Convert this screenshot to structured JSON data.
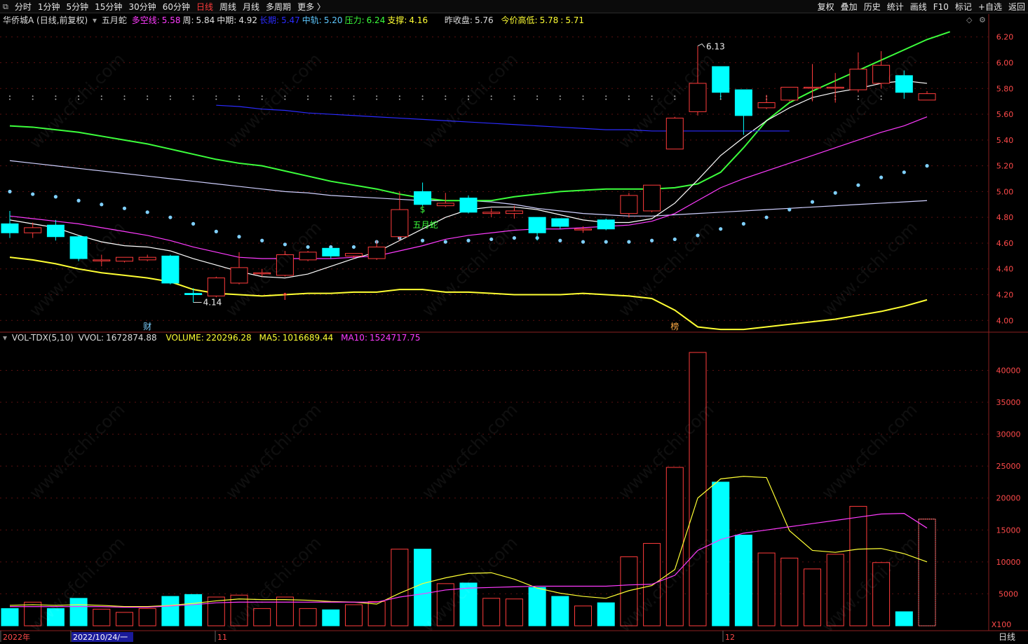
{
  "toolbar": {
    "left_icon": "stack-icon",
    "left": [
      "分时",
      "1分钟",
      "5分钟",
      "15分钟",
      "30分钟",
      "60分钟",
      "日线",
      "周线",
      "月线",
      "多周期",
      "更多 〉"
    ],
    "active": "日线",
    "right": [
      "复权",
      "叠加",
      "历史",
      "统计",
      "画线",
      "F10",
      "标记",
      "+自选",
      "返回"
    ]
  },
  "infobar": {
    "stock": "华侨城A (日线,前复权)",
    "indicator": "五月蛇",
    "fields": [
      {
        "label": "多空线:",
        "value": "5.58",
        "color": "#ff3bff"
      },
      {
        "label": "周:",
        "value": "5.84",
        "color": "#e0e0e0"
      },
      {
        "label": "中期:",
        "value": "4.92",
        "color": "#e0e0e0"
      },
      {
        "label": "长期:",
        "value": "5.47",
        "color": "#2b2bff"
      },
      {
        "label": "中轨:",
        "value": "5.20",
        "color": "#5ec8ff"
      },
      {
        "label": "压力:",
        "value": "6.24",
        "color": "#3cff3c"
      },
      {
        "label": "支撑:",
        "value": "4.16",
        "color": "#ffff33"
      }
    ],
    "prev_close_label": "昨收盘:",
    "prev_close": "5.76",
    "today_label": "今价高低:",
    "today_high": "5.78",
    "today_sep": ":",
    "today_low": "5.71"
  },
  "volbar": {
    "name": "VOL-TDX(5,10)",
    "vvol_label": "VVOL:",
    "vvol": "1672874.88",
    "volume_label": "VOLUME:",
    "volume": "220296.28",
    "ma5_label": "MA5:",
    "ma5": "1016689.44",
    "ma10_label": "MA10:",
    "ma10": "1524717.75"
  },
  "price_axis": [
    "6.20",
    "6.00",
    "5.80",
    "5.60",
    "5.40",
    "5.20",
    "5.00",
    "4.80",
    "4.60",
    "4.40",
    "4.20",
    "4.00"
  ],
  "volume_axis": [
    "40000",
    "35000",
    "30000",
    "25000",
    "20000",
    "15000",
    "10000",
    "5000"
  ],
  "volume_unit": "X100",
  "date_axis": {
    "labels": [
      "2022年",
      "2022/10/24/一",
      "11",
      "12"
    ],
    "period": "日线"
  },
  "annotations": {
    "high": "6.13",
    "low": "4.14",
    "signal": "五月蛇",
    "marker_cai": "财",
    "marker_bang": "榜"
  },
  "watermark": "www.cfchi.com",
  "colors": {
    "up": "#ff3b3b",
    "down": "#00ffff",
    "ma_white": "#ffffff",
    "ma_magenta": "#ff3bff",
    "resist": "#3cff3c",
    "support": "#ffff33",
    "long": "#2b2bff",
    "mid": "#d0d0ff",
    "dots": "#7fd0ff"
  },
  "chart_data": {
    "type": "candlestick",
    "price_range": [
      3.92,
      6.28
    ],
    "volume_range": [
      0,
      44000
    ],
    "candles": [
      {
        "o": 4.75,
        "h": 4.85,
        "l": 4.64,
        "c": 4.68
      },
      {
        "o": 4.68,
        "h": 4.76,
        "l": 4.64,
        "c": 4.72
      },
      {
        "o": 4.74,
        "h": 4.78,
        "l": 4.62,
        "c": 4.65
      },
      {
        "o": 4.65,
        "h": 4.66,
        "l": 4.46,
        "c": 4.48
      },
      {
        "o": 4.47,
        "h": 4.51,
        "l": 4.42,
        "c": 4.47
      },
      {
        "o": 4.46,
        "h": 4.49,
        "l": 4.45,
        "c": 4.49
      },
      {
        "o": 4.47,
        "h": 4.51,
        "l": 4.46,
        "c": 4.49
      },
      {
        "o": 4.5,
        "h": 4.51,
        "l": 4.28,
        "c": 4.29
      },
      {
        "o": 4.21,
        "h": 4.25,
        "l": 4.14,
        "c": 4.2
      },
      {
        "o": 4.19,
        "h": 4.34,
        "l": 4.18,
        "c": 4.33
      },
      {
        "o": 4.29,
        "h": 4.53,
        "l": 4.28,
        "c": 4.41
      },
      {
        "o": 4.37,
        "h": 4.4,
        "l": 4.34,
        "c": 4.37
      },
      {
        "o": 4.35,
        "h": 4.54,
        "l": 4.34,
        "c": 4.51
      },
      {
        "o": 4.47,
        "h": 4.54,
        "l": 4.46,
        "c": 4.53
      },
      {
        "o": 4.56,
        "h": 4.56,
        "l": 4.48,
        "c": 4.5
      },
      {
        "o": 4.5,
        "h": 4.52,
        "l": 4.48,
        "c": 4.52
      },
      {
        "o": 4.48,
        "h": 4.62,
        "l": 4.47,
        "c": 4.57
      },
      {
        "o": 4.65,
        "h": 5.0,
        "l": 4.62,
        "c": 4.86
      },
      {
        "o": 5.0,
        "h": 5.07,
        "l": 4.89,
        "c": 4.9
      },
      {
        "o": 4.89,
        "h": 4.99,
        "l": 4.88,
        "c": 4.91
      },
      {
        "o": 4.95,
        "h": 4.97,
        "l": 4.83,
        "c": 4.84
      },
      {
        "o": 4.83,
        "h": 4.87,
        "l": 4.8,
        "c": 4.84
      },
      {
        "o": 4.83,
        "h": 4.89,
        "l": 4.79,
        "c": 4.85
      },
      {
        "o": 4.8,
        "h": 4.8,
        "l": 4.62,
        "c": 4.68
      },
      {
        "o": 4.79,
        "h": 4.79,
        "l": 4.71,
        "c": 4.73
      },
      {
        "o": 4.71,
        "h": 4.73,
        "l": 4.68,
        "c": 4.71
      },
      {
        "o": 4.78,
        "h": 4.79,
        "l": 4.7,
        "c": 4.71
      },
      {
        "o": 4.83,
        "h": 4.99,
        "l": 4.8,
        "c": 4.97
      },
      {
        "o": 4.85,
        "h": 5.05,
        "l": 4.84,
        "c": 5.05
      },
      {
        "o": 5.33,
        "h": 5.58,
        "l": 5.33,
        "c": 5.57
      },
      {
        "o": 5.62,
        "h": 6.13,
        "l": 5.59,
        "c": 5.84
      },
      {
        "o": 5.97,
        "h": 5.97,
        "l": 5.72,
        "c": 5.77
      },
      {
        "o": 5.79,
        "h": 5.79,
        "l": 5.44,
        "c": 5.59
      },
      {
        "o": 5.65,
        "h": 5.75,
        "l": 5.64,
        "c": 5.69
      },
      {
        "o": 5.71,
        "h": 5.81,
        "l": 5.7,
        "c": 5.81
      },
      {
        "o": 5.81,
        "h": 5.99,
        "l": 5.7,
        "c": 5.81
      },
      {
        "o": 5.81,
        "h": 5.92,
        "l": 5.69,
        "c": 5.81
      },
      {
        "o": 5.79,
        "h": 6.08,
        "l": 5.77,
        "c": 5.95
      },
      {
        "o": 5.84,
        "h": 6.09,
        "l": 5.8,
        "c": 5.98
      },
      {
        "o": 5.9,
        "h": 5.94,
        "l": 5.72,
        "c": 5.77
      },
      {
        "o": 5.71,
        "h": 5.78,
        "l": 5.71,
        "c": 5.76
      }
    ],
    "volume": [
      2700,
      3700,
      2700,
      4300,
      2600,
      2100,
      2700,
      4600,
      4900,
      4500,
      4800,
      2700,
      4500,
      2700,
      2500,
      3300,
      3800,
      12000,
      12000,
      6600,
      6700,
      4300,
      4200,
      6000,
      4600,
      3100,
      3600,
      10800,
      12900,
      24800,
      42800,
      22500,
      14200,
      11400,
      10600,
      8900,
      11200,
      18700,
      9900,
      2200,
      16700
    ],
    "ma5": [
      3200,
      3300,
      3200,
      3300,
      3200,
      3000,
      3000,
      3200,
      3500,
      3900,
      4200,
      4100,
      4100,
      4000,
      3800,
      3700,
      3400,
      5100,
      6600,
      7500,
      8200,
      8300,
      7300,
      5900,
      5100,
      4600,
      4300,
      5500,
      6300,
      8800,
      20000,
      23000,
      23400,
      23200,
      14900,
      11800,
      11500,
      12000,
      12100,
      11300,
      10000
    ],
    "ma10": [
      3000,
      3000,
      3000,
      3000,
      3000,
      2900,
      2900,
      3100,
      3300,
      3600,
      3700,
      3700,
      3700,
      3700,
      3700,
      3700,
      3700,
      4500,
      5000,
      5600,
      5900,
      6000,
      6100,
      6200,
      6200,
      6200,
      6200,
      6400,
      6500,
      7900,
      11800,
      13500,
      14500,
      15000,
      15500,
      16000,
      16500,
      17000,
      17500,
      17600,
      15300
    ],
    "ma_white": [
      5.24,
      5.22,
      5.2,
      5.18,
      5.16,
      5.14,
      5.12,
      5.1,
      5.08,
      5.06,
      5.04,
      5.02,
      5.0,
      4.99,
      4.97,
      4.96,
      4.95,
      4.94,
      4.93,
      4.93,
      4.93,
      4.92,
      4.9,
      4.87,
      4.85,
      4.83,
      4.82,
      4.81,
      4.81,
      4.82,
      4.83,
      4.84,
      4.85,
      4.86,
      4.87,
      4.88,
      4.89,
      4.9,
      4.91,
      4.92,
      4.93
    ],
    "ma_fast": [
      4.78,
      4.75,
      4.72,
      4.66,
      4.61,
      4.58,
      4.57,
      4.54,
      4.48,
      4.43,
      4.38,
      4.34,
      4.33,
      4.36,
      4.42,
      4.48,
      4.53,
      4.62,
      4.71,
      4.8,
      4.86,
      4.88,
      4.88,
      4.86,
      4.82,
      4.78,
      4.76,
      4.76,
      4.79,
      4.91,
      5.09,
      5.28,
      5.42,
      5.55,
      5.65,
      5.73,
      5.77,
      5.8,
      5.84,
      5.86,
      5.84
    ],
    "ma_magenta": [
      4.81,
      4.79,
      4.77,
      4.75,
      4.72,
      4.69,
      4.66,
      4.62,
      4.57,
      4.53,
      4.49,
      4.48,
      4.48,
      4.48,
      4.48,
      4.49,
      4.5,
      4.54,
      4.58,
      4.63,
      4.66,
      4.68,
      4.7,
      4.71,
      4.71,
      4.72,
      4.73,
      4.74,
      4.77,
      4.83,
      4.93,
      5.03,
      5.1,
      5.16,
      5.22,
      5.28,
      5.34,
      5.4,
      5.46,
      5.51,
      5.58
    ],
    "resist": [
      5.51,
      5.5,
      5.48,
      5.46,
      5.43,
      5.4,
      5.37,
      5.33,
      5.29,
      5.25,
      5.22,
      5.2,
      5.16,
      5.12,
      5.08,
      5.05,
      5.02,
      4.98,
      4.95,
      4.93,
      4.93,
      4.93,
      4.96,
      4.98,
      5.0,
      5.01,
      5.02,
      5.02,
      5.02,
      5.03,
      5.06,
      5.15,
      5.34,
      5.55,
      5.69,
      5.78,
      5.86,
      5.94,
      6.02,
      6.1,
      6.18,
      6.24
    ],
    "support": [
      4.49,
      4.47,
      4.44,
      4.4,
      4.37,
      4.35,
      4.33,
      4.3,
      4.24,
      4.21,
      4.2,
      4.19,
      4.2,
      4.21,
      4.21,
      4.22,
      4.22,
      4.24,
      4.24,
      4.22,
      4.22,
      4.21,
      4.2,
      4.2,
      4.2,
      4.21,
      4.2,
      4.19,
      4.17,
      4.08,
      3.95,
      3.93,
      3.93,
      3.95,
      3.97,
      3.99,
      4.01,
      4.04,
      4.07,
      4.11,
      4.16
    ],
    "long_line": [
      5.67,
      5.66,
      5.64,
      5.63,
      5.61,
      5.6,
      5.59,
      5.58,
      5.57,
      5.56,
      5.55,
      5.54,
      5.53,
      5.52,
      5.51,
      5.5,
      5.49,
      5.48,
      5.48,
      5.47,
      5.47,
      5.47,
      5.47,
      5.47,
      5.47,
      5.47
    ],
    "sar": [
      5.0,
      4.98,
      4.96,
      4.93,
      4.9,
      4.87,
      4.84,
      4.8,
      4.75,
      4.69,
      4.65,
      4.62,
      4.59,
      4.57,
      4.57,
      4.57,
      4.61,
      4.64,
      4.62,
      4.61,
      4.62,
      4.63,
      4.64,
      4.64,
      4.62,
      4.61,
      4.61,
      4.61,
      4.62,
      4.63,
      4.66,
      4.71,
      4.75,
      4.8,
      4.86,
      4.92,
      4.99,
      5.05,
      5.11,
      5.15,
      5.2
    ]
  }
}
